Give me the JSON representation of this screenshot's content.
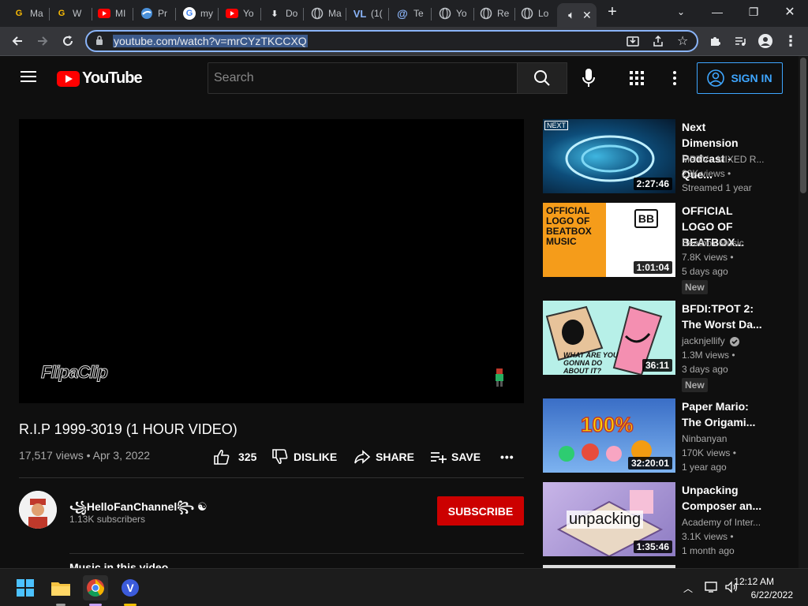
{
  "browser": {
    "tabs": [
      {
        "label": "Ma",
        "icon": "google-g-icon"
      },
      {
        "label": "W",
        "icon": "google-g-icon"
      },
      {
        "label": "MI",
        "icon": "youtube-icon"
      },
      {
        "label": "Pr",
        "icon": "blue-site-icon"
      },
      {
        "label": "my",
        "icon": "google-icon"
      },
      {
        "label": "Yo",
        "icon": "youtube-icon"
      },
      {
        "label": "Do",
        "icon": "download-icon"
      },
      {
        "label": "Ma",
        "icon": "globe-icon"
      },
      {
        "label": "(1(",
        "icon": "vl-icon"
      },
      {
        "label": "Te",
        "icon": "at-icon"
      },
      {
        "label": "Yo",
        "icon": "globe-icon"
      },
      {
        "label": "Re",
        "icon": "globe-icon"
      },
      {
        "label": "Lo",
        "icon": "globe-icon"
      }
    ],
    "url": "youtube.com/watch?v=mrCYzTKCCXQ"
  },
  "youtube": {
    "logo_text": "YouTube",
    "search_placeholder": "Search",
    "signin_label": "SIGN IN",
    "video": {
      "watermark": "FlipaClip",
      "title": "R.I.P 1999-3019 (1 HOUR VIDEO)",
      "meta": "17,517 views • Apr 3, 2022",
      "like_count": "325",
      "dislike_label": "DISLIKE",
      "share_label": "SHARE",
      "save_label": "SAVE",
      "more_label": "•••"
    },
    "channel": {
      "name": "꧁HelloFanChannel꧂ ☯",
      "subscribers": "1.13K subscribers",
      "subscribe_label": "SUBSCRIBE"
    },
    "music_heading": "Music in this video",
    "recommendations": [
      {
        "title": "Next Dimension Podcast - Que...",
        "channel": "MRTV - MIXED R...",
        "views": "22K views •",
        "date": "Streamed 1 year",
        "duration": "2:27:46",
        "badge": "",
        "thumb_label": "NEXT"
      },
      {
        "title": "OFFICIAL LOGO OF BEATBOX...",
        "channel": "Beatbox Music",
        "views": "7.8K views •",
        "date": "5 days ago",
        "duration": "1:01:04",
        "badge": "New",
        "thumb_label": "OFFICIAL LOGO OF BEATBOX MUSIC"
      },
      {
        "title": "BFDI:TPOT 2: The Worst Da...",
        "channel": "jacknjellify",
        "views": "1.3M views •",
        "date": "3 days ago",
        "duration": "36:11",
        "badge": "New",
        "thumb_label": "WHAT ARE YOU GONNA DO ABOUT IT?"
      },
      {
        "title": "Paper Mario: The Origami...",
        "channel": "Ninbanyan",
        "views": "170K views •",
        "date": "1 year ago",
        "duration": "32:20:01",
        "badge": "",
        "thumb_label": "100%"
      },
      {
        "title": "Unpacking Composer an...",
        "channel": "Academy of Inter...",
        "views": "3.1K views •",
        "date": "1 month ago",
        "duration": "1:35:46",
        "badge": "",
        "thumb_label": "unpacking"
      }
    ]
  },
  "taskbar": {
    "time": "12:12 AM",
    "date": "6/22/2022"
  },
  "colors": {
    "yt_red": "#ff0000",
    "subscribe_red": "#cc0000",
    "signin_blue": "#3ea6ff",
    "bg": "#0f0f0f"
  }
}
